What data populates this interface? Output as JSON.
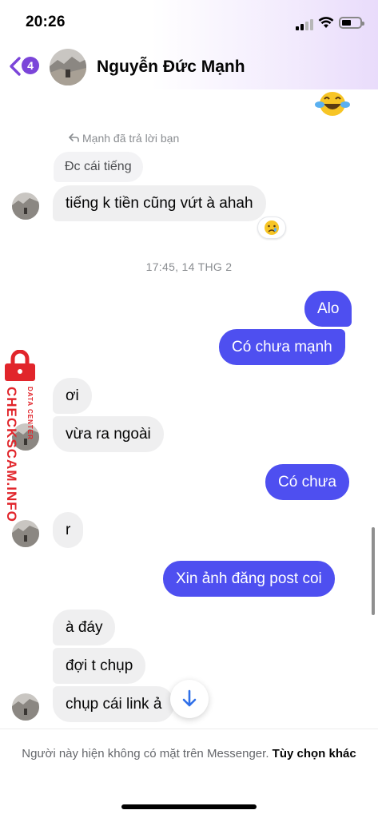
{
  "status_bar": {
    "time": "20:26"
  },
  "header": {
    "back_badge_count": "4",
    "contact_name": "Nguyễn Đức Mạnh"
  },
  "conversation": {
    "reply_note": "Mạnh đã trả lời bạn",
    "quoted_message": "Đc cái tiếng",
    "timestamp": "17:45, 14 THG 2",
    "messages": [
      {
        "from": "contact",
        "text": "tiếng k tiền cũng vứt à ahah"
      },
      {
        "from": "me",
        "text": "Alo"
      },
      {
        "from": "me",
        "text": "Có chưa mạnh"
      },
      {
        "from": "contact",
        "text": "ơi"
      },
      {
        "from": "contact",
        "text": "vừa ra ngoài"
      },
      {
        "from": "me",
        "text": "Có chưa"
      },
      {
        "from": "contact",
        "text": "r"
      },
      {
        "from": "me",
        "text": "Xin ảnh đăng post coi"
      },
      {
        "from": "contact",
        "text": "à đáy"
      },
      {
        "from": "contact",
        "text": "đợi t chụp"
      },
      {
        "from": "contact",
        "text": "chụp cái link ả"
      }
    ]
  },
  "watermark": {
    "main": "CHECKSCAM.INFO",
    "sub": "DATA CENTER"
  },
  "footer": {
    "notice": "Người này hiện không có mặt trên Messenger.",
    "link": "Tùy chọn khác"
  },
  "icons": {
    "reaction": "crying-face-icon",
    "laugh": "tears-of-joy-icon",
    "scroll": "arrow-down-icon"
  },
  "colors": {
    "outgoing_bubble": "#4e4ff0",
    "incoming_bubble": "#efeff0",
    "accent": "#7b45d9",
    "watermark": "#e1252b"
  }
}
